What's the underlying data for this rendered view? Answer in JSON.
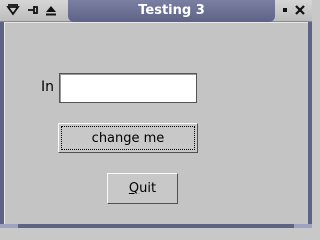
{
  "window": {
    "title": "Testing 3"
  },
  "titlebar_icons": {
    "menu": "triangle-down-icon",
    "shade": "pin-icon",
    "raise": "eject-icon",
    "iconify": "small-square-icon",
    "close": "close-icon"
  },
  "form": {
    "in_label": "In",
    "in_value": ""
  },
  "buttons": {
    "change_label": "change me",
    "quit_label": "Quit"
  },
  "colors": {
    "title_bar": "#5e6286",
    "title_text": "#ffffff",
    "background": "#c4c4c4"
  }
}
